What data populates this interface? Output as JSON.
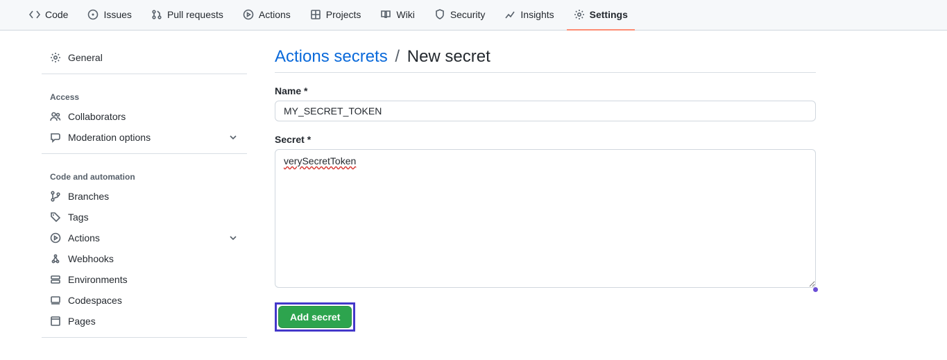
{
  "repoNav": {
    "items": [
      {
        "label": "Code"
      },
      {
        "label": "Issues"
      },
      {
        "label": "Pull requests"
      },
      {
        "label": "Actions"
      },
      {
        "label": "Projects"
      },
      {
        "label": "Wiki"
      },
      {
        "label": "Security"
      },
      {
        "label": "Insights"
      },
      {
        "label": "Settings"
      }
    ]
  },
  "sidebar": {
    "general": "General",
    "heading_access": "Access",
    "collaborators": "Collaborators",
    "moderation": "Moderation options",
    "heading_code": "Code and automation",
    "branches": "Branches",
    "tags": "Tags",
    "actions": "Actions",
    "webhooks": "Webhooks",
    "environments": "Environments",
    "codespaces": "Codespaces",
    "pages": "Pages"
  },
  "breadcrumb": {
    "parent": "Actions secrets",
    "sep": "/",
    "current": "New secret"
  },
  "form": {
    "name_label": "Name *",
    "name_value": "MY_SECRET_TOKEN",
    "secret_label": "Secret *",
    "secret_value": "verySecretToken",
    "submit_label": "Add secret"
  }
}
